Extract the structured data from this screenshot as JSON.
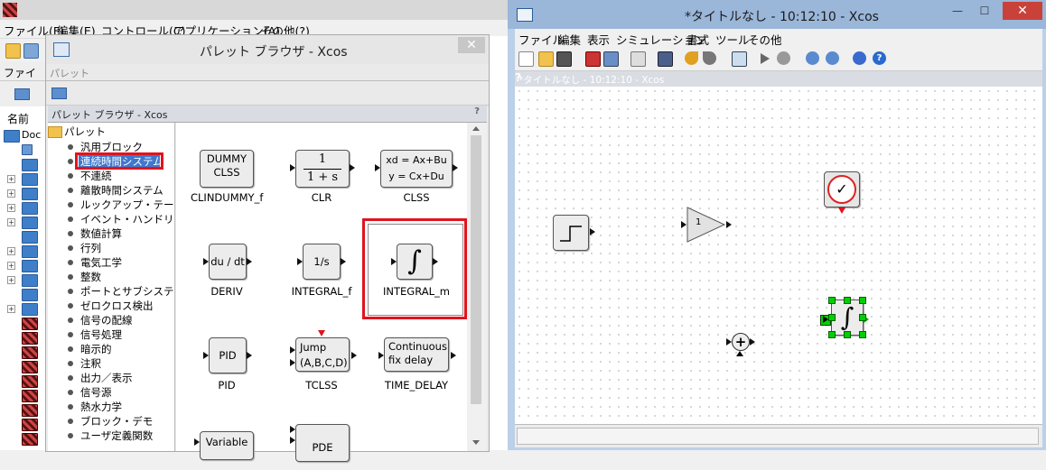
{
  "console": {
    "menus": [
      "ファイル(F)",
      "編集(E)",
      "コントロール(C)",
      "アプリケーション(A)",
      "その他(?)"
    ],
    "file_tab": "ファイ",
    "name_header": "名前",
    "doc_item": "Doc"
  },
  "palette_browser": {
    "title": "パレット ブラウザ - Xcos",
    "tab_label": "パレット",
    "inner_title": "パレット ブラウザ - Xcos",
    "help": "?",
    "close": "✕",
    "tree_root": "パレット",
    "tree_items": [
      "汎用ブロック",
      "連続時間システム",
      "不連続",
      "離散時間システム",
      "ルックアップ・テーブル",
      "イベント・ハンドリング",
      "数値計算",
      "行列",
      "電気工学",
      "整数",
      "ポートとサブシステム",
      "ゼロクロス検出",
      "信号の配線",
      "信号処理",
      "暗示的",
      "注釈",
      "出力／表示",
      "信号源",
      "熱水力学",
      "ブロック・デモ",
      "ユーザ定義関数"
    ],
    "selected_index": 1,
    "blocks": [
      {
        "name": "CLINDUMMY_f",
        "text": [
          "DUMMY",
          "CLSS"
        ]
      },
      {
        "name": "CLR",
        "text": [
          "1",
          "1 + s"
        ]
      },
      {
        "name": "CLSS",
        "text": [
          "xd = Ax+Bu",
          "y = Cx+Du"
        ]
      },
      {
        "name": "DERIV",
        "text": [
          "du / dt"
        ]
      },
      {
        "name": "INTEGRAL_f",
        "text": [
          "1/s"
        ]
      },
      {
        "name": "INTEGRAL_m",
        "text": [
          "∫"
        ]
      },
      {
        "name": "PID",
        "text": [
          "PID"
        ]
      },
      {
        "name": "TCLSS",
        "text": [
          "Jump",
          "(A,B,C,D)"
        ]
      },
      {
        "name": "TIME_DELAY",
        "text": [
          "Continuous",
          "fix delay"
        ]
      },
      {
        "name": "",
        "text": [
          "Variable"
        ]
      },
      {
        "name": "",
        "text": [
          "PDE"
        ]
      }
    ]
  },
  "xcos": {
    "title": "*タイトルなし - 10:12:10 - Xcos",
    "inner_title": "*タイトルなし - 10:12:10 - Xcos",
    "help": "?",
    "menus": [
      "ファイル",
      "編集",
      "表示",
      "シミュレーション",
      "書式",
      "ツール",
      "その他"
    ],
    "gain_value": "1",
    "integral_symbol": "∫",
    "sum_symbol": "+",
    "clock_symbol": "✓",
    "close": "✕",
    "minimize": "—",
    "maximize": "☐"
  },
  "colors": {
    "highlight_red": "#e0141e",
    "selection_blue": "#3f78cf",
    "xcos_title_bg": "#9ab6d9",
    "handle_green": "#00d000"
  }
}
